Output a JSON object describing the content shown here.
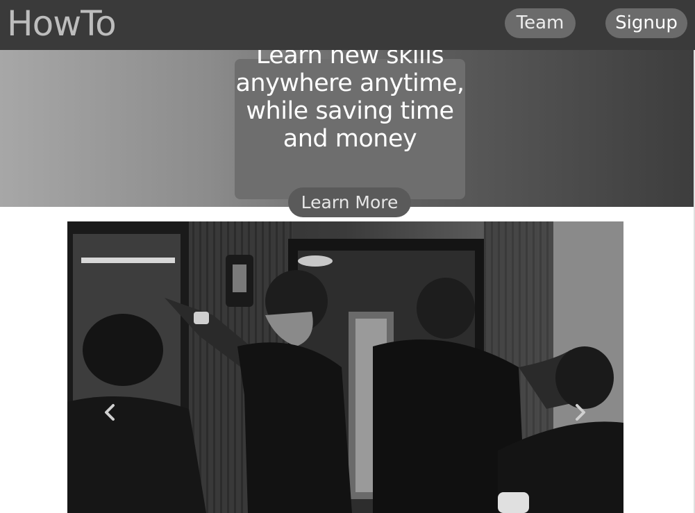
{
  "header": {
    "brand": "HowTo",
    "nav": [
      {
        "label": "Team"
      },
      {
        "label": "Signup"
      }
    ]
  },
  "hero": {
    "headline": "Learn new skills anywhere anytime, while saving time and money",
    "cta_label": "Learn More"
  },
  "carousel": {
    "prev_icon": "chevron-left-icon",
    "next_icon": "chevron-right-icon"
  },
  "colors": {
    "navbar": "#3a3a3a",
    "button": "#6b6b6b",
    "cta": "#5a5a5a"
  }
}
